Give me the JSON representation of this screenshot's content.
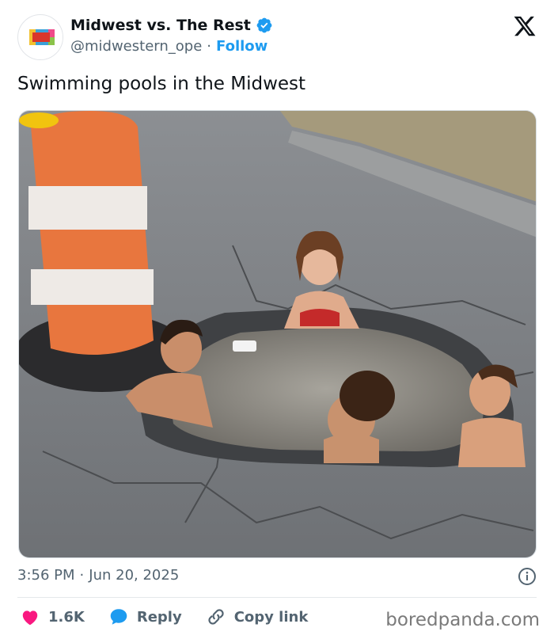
{
  "author": {
    "display_name": "Midwest vs. The Rest",
    "handle": "@midwestern_ope",
    "separator": "·",
    "follow_label": "Follow",
    "avatar_text_top": "MIDWEST",
    "avatar_text_center": "OPE",
    "avatar_text_bottom": "VS THE REST",
    "verified": true
  },
  "tweet": {
    "text": "Swimming pools in the Midwest"
  },
  "meta": {
    "time": "3:56 PM",
    "separator": "·",
    "date": "Jun 20, 2025"
  },
  "actions": {
    "like_count": "1.6K",
    "reply_label": "Reply",
    "copy_link_label": "Copy link"
  },
  "watermark": "boredpanda.com",
  "colors": {
    "link": "#1d9bf0",
    "like": "#f91880",
    "text": "#0f1419",
    "secondary": "#536471"
  },
  "icons": [
    "x-logo-icon",
    "verified-badge-icon",
    "info-icon",
    "heart-icon",
    "reply-bubble-icon",
    "link-icon"
  ]
}
